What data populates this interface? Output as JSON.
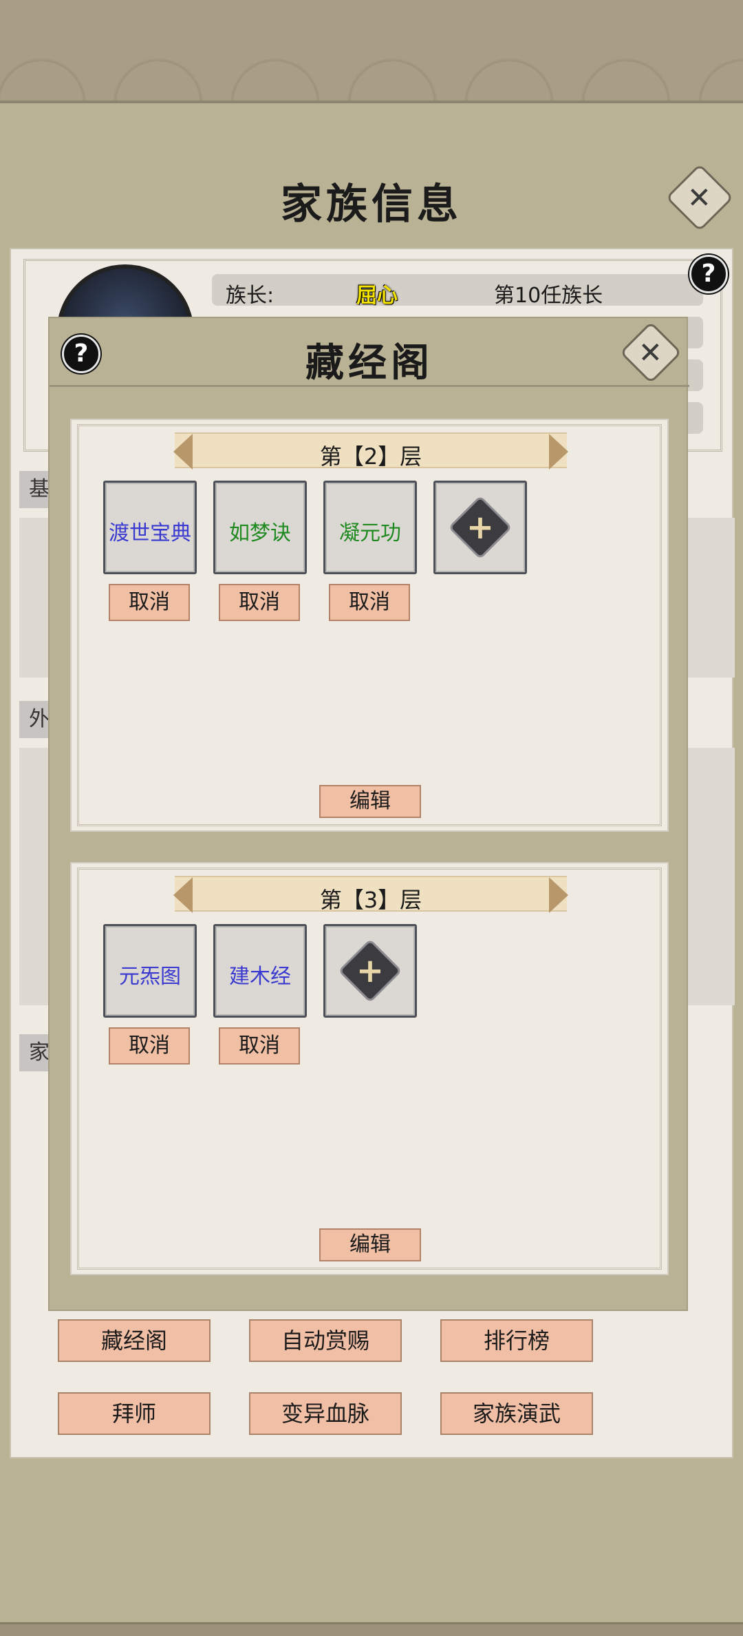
{
  "family_info": {
    "title": "家族信息",
    "leader_label": "族长:",
    "leader_name": "屈心",
    "leader_rank": "第10任族长",
    "section_tabs": [
      "基",
      "外",
      "家"
    ]
  },
  "library": {
    "title": "藏经阁",
    "floors": [
      {
        "label": "第【2】层",
        "slots": [
          {
            "name": "渡世宝典",
            "color": "#3a3ad0"
          },
          {
            "name": "如梦诀",
            "color": "#1f8a1f"
          },
          {
            "name": "凝元功",
            "color": "#1f8a1f"
          }
        ],
        "cancel_label": "取消",
        "edit_label": "编辑"
      },
      {
        "label": "第【3】层",
        "slots": [
          {
            "name": "元炁图",
            "color": "#3a3ad0"
          },
          {
            "name": "建木经",
            "color": "#3a3ad0"
          }
        ],
        "cancel_label": "取消",
        "edit_label": "编辑"
      }
    ]
  },
  "actions": [
    "藏经阁",
    "自动赏赐",
    "排行榜",
    "拜师",
    "变异血脉",
    "家族演武"
  ],
  "icons": {
    "close": "close-icon",
    "help": "help-icon",
    "add": "plus-icon"
  }
}
